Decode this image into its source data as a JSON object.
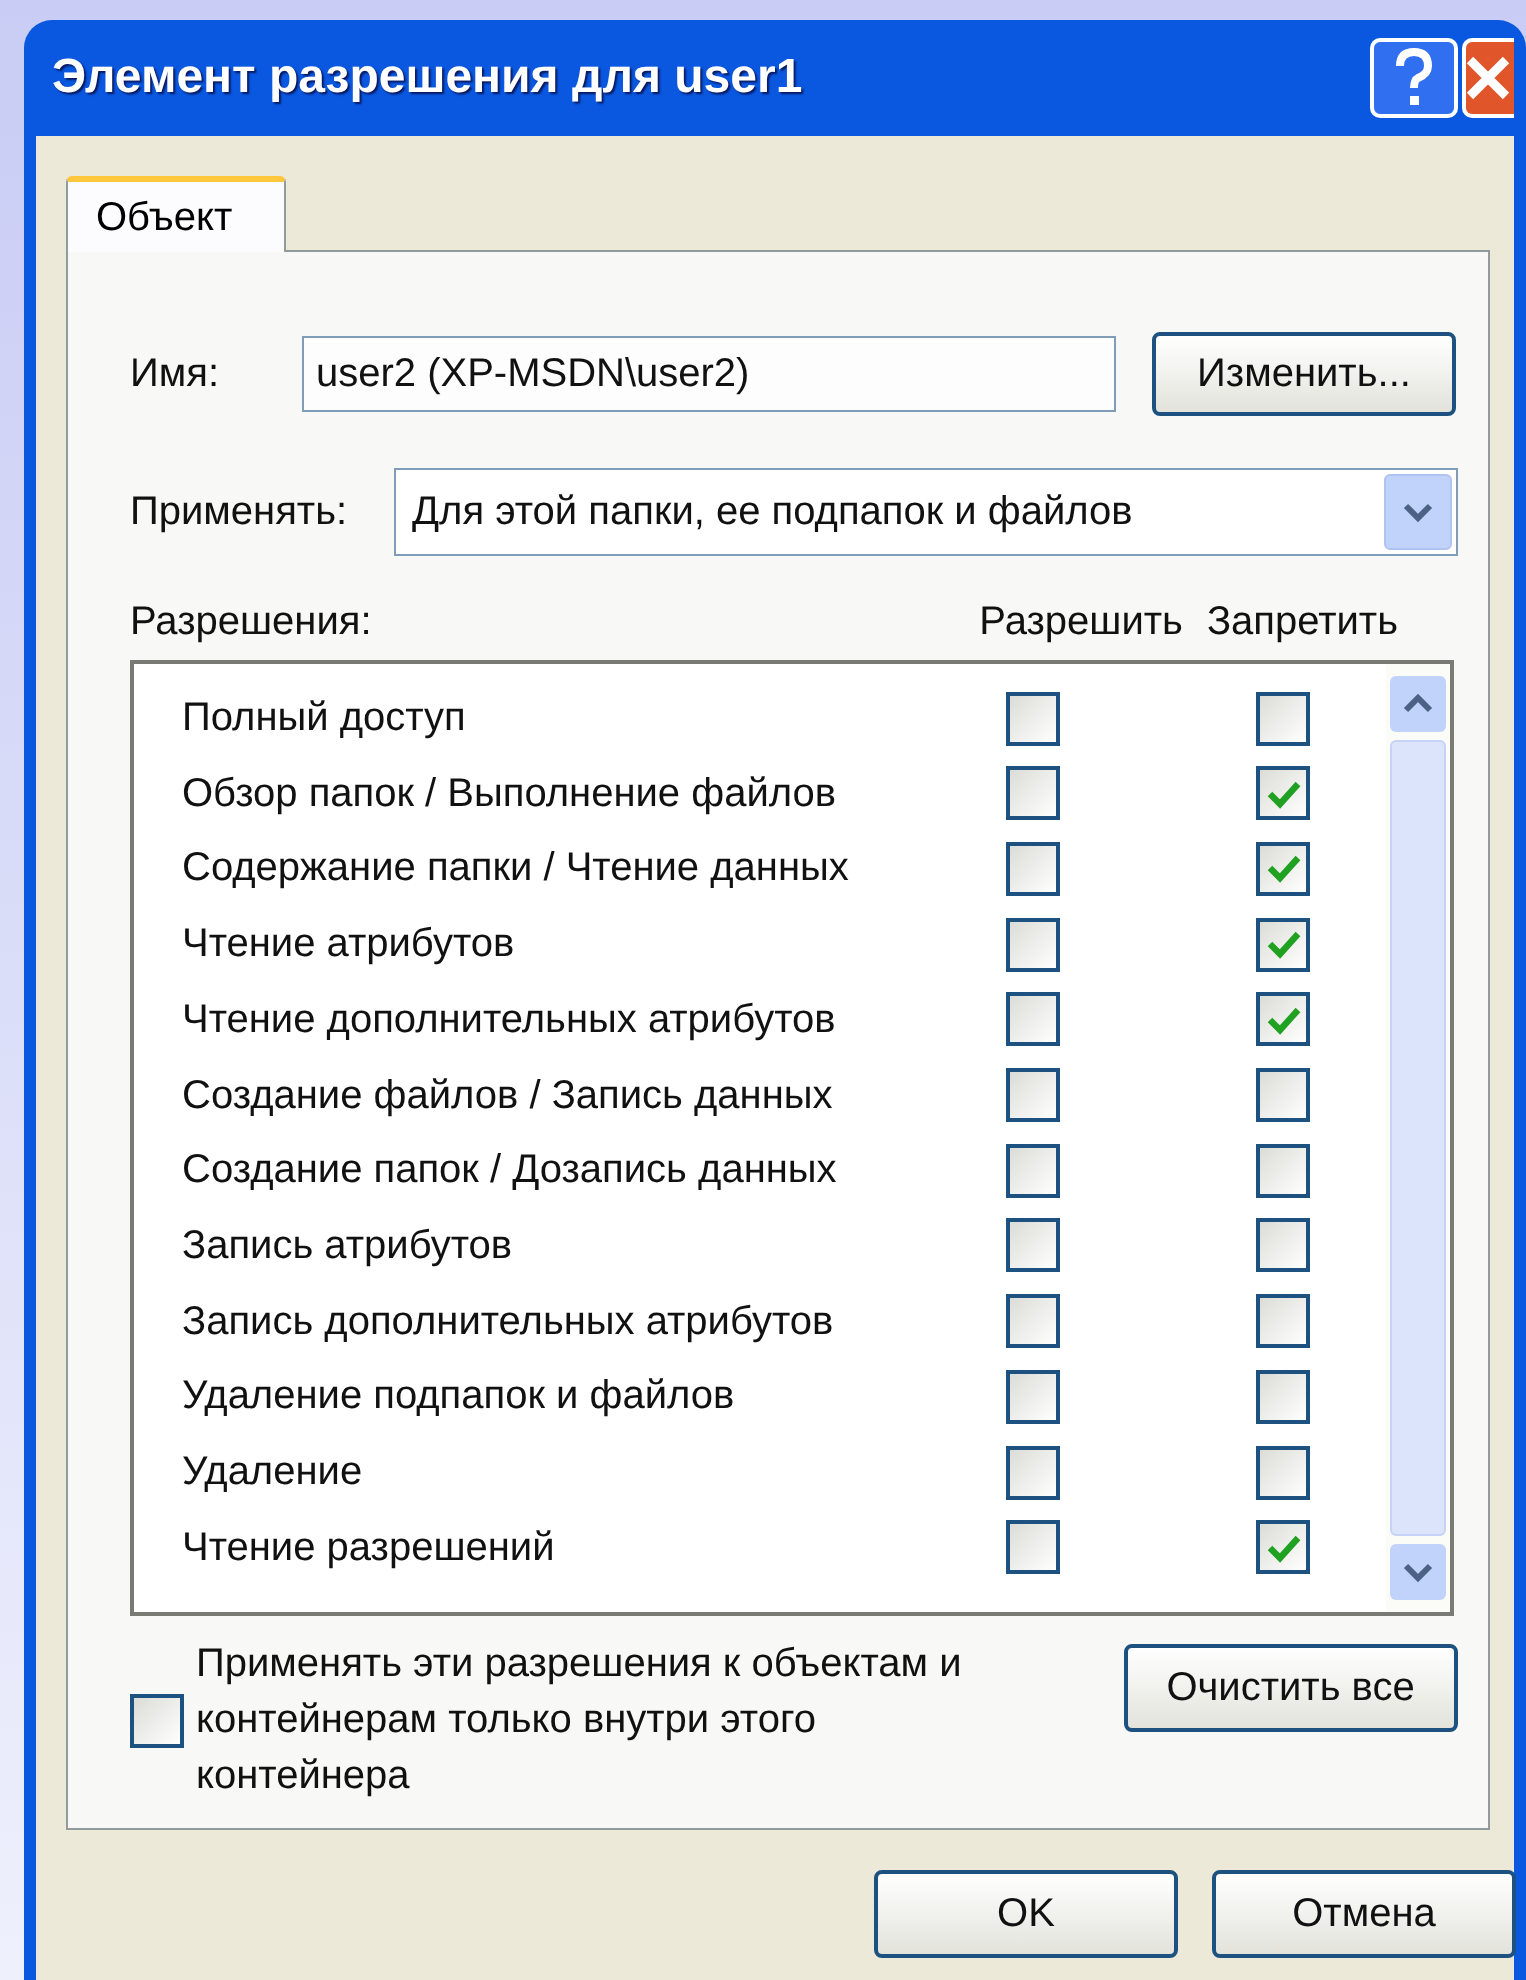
{
  "window": {
    "title": "Элемент разрешения для user1"
  },
  "tabs": [
    {
      "label": "Объект",
      "selected": true
    }
  ],
  "name_field": {
    "label": "Имя:",
    "value": "user2 (XP-MSDN\\user2)",
    "button": "Изменить..."
  },
  "apply_to": {
    "label": "Применять:",
    "value": "Для этой папки, ее подпапок и файлов"
  },
  "permissions": {
    "label": "Разрешения:",
    "columns": [
      "Разрешить",
      "Запретить"
    ],
    "rows": [
      {
        "name": "Полный доступ",
        "allow": false,
        "deny": false
      },
      {
        "name": "Обзор папок / Выполнение файлов",
        "allow": false,
        "deny": true
      },
      {
        "name": "Содержание папки / Чтение данных",
        "allow": false,
        "deny": true
      },
      {
        "name": "Чтение атрибутов",
        "allow": false,
        "deny": true
      },
      {
        "name": "Чтение дополнительных атрибутов",
        "allow": false,
        "deny": true
      },
      {
        "name": "Создание файлов / Запись данных",
        "allow": false,
        "deny": false
      },
      {
        "name": "Создание папок / Дозапись данных",
        "allow": false,
        "deny": false
      },
      {
        "name": "Запись атрибутов",
        "allow": false,
        "deny": false
      },
      {
        "name": "Запись дополнительных атрибутов",
        "allow": false,
        "deny": false
      },
      {
        "name": "Удаление подпапок и файлов",
        "allow": false,
        "deny": false
      },
      {
        "name": "Удаление",
        "allow": false,
        "deny": false
      },
      {
        "name": "Чтение разрешений",
        "allow": false,
        "deny": true
      }
    ]
  },
  "apply_inside": {
    "label": "Применять эти разрешения к объектам и контейнерам только внутри этого контейнера",
    "checked": false
  },
  "clear_button": "Очистить все",
  "buttons": [
    "OK",
    "Отмена"
  ]
}
